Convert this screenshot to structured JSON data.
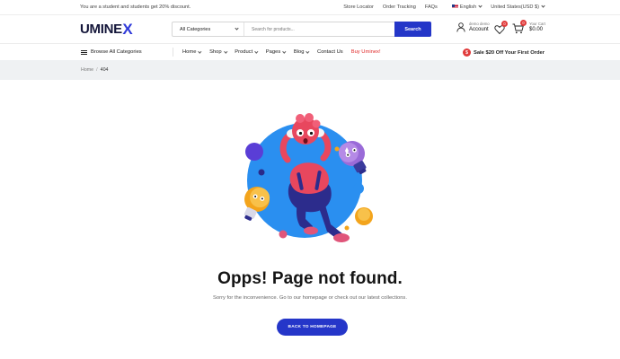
{
  "topbar": {
    "promo": "You are a student and students get 20% discount.",
    "links": [
      "Store Locator",
      "Order Tracking",
      "FAQs"
    ],
    "language": "English",
    "currency": "United States(USD $)"
  },
  "header": {
    "logo_main": "UMINE",
    "logo_accent": "X",
    "search_category": "All Categories",
    "search_placeholder": "Search for products...",
    "search_button": "Search",
    "account_small": "demo demo",
    "account_label": "Account",
    "wishlist_count": "0",
    "cart_count": "0",
    "cart_small": "Your Cart",
    "cart_total": "$0.00"
  },
  "nav": {
    "browse": "Browse All Categories",
    "items": [
      "Home",
      "Shop",
      "Product",
      "Pages",
      "Blog"
    ],
    "contact": "Contact Us",
    "buy": "Buy Uminex!",
    "sale": "Sale $20 Off Your First Order"
  },
  "breadcrumb": {
    "home": "Home",
    "separator": "/",
    "current": "404"
  },
  "notfound": {
    "title": "Opps! Page not found.",
    "description": "Sorry for the inconvenience. Go to our homepage or check out our latest collections.",
    "button": "BACK TO HOMEPAGE"
  },
  "colors": {
    "brand": "#2436c8",
    "accent_red": "#e03b3b",
    "illustration_circle": "#2a8ff0"
  },
  "icons": [
    "flag-us-icon",
    "chevron-down-icon",
    "user-icon",
    "heart-icon",
    "cart-icon",
    "menu-icon",
    "sale-badge-icon"
  ]
}
